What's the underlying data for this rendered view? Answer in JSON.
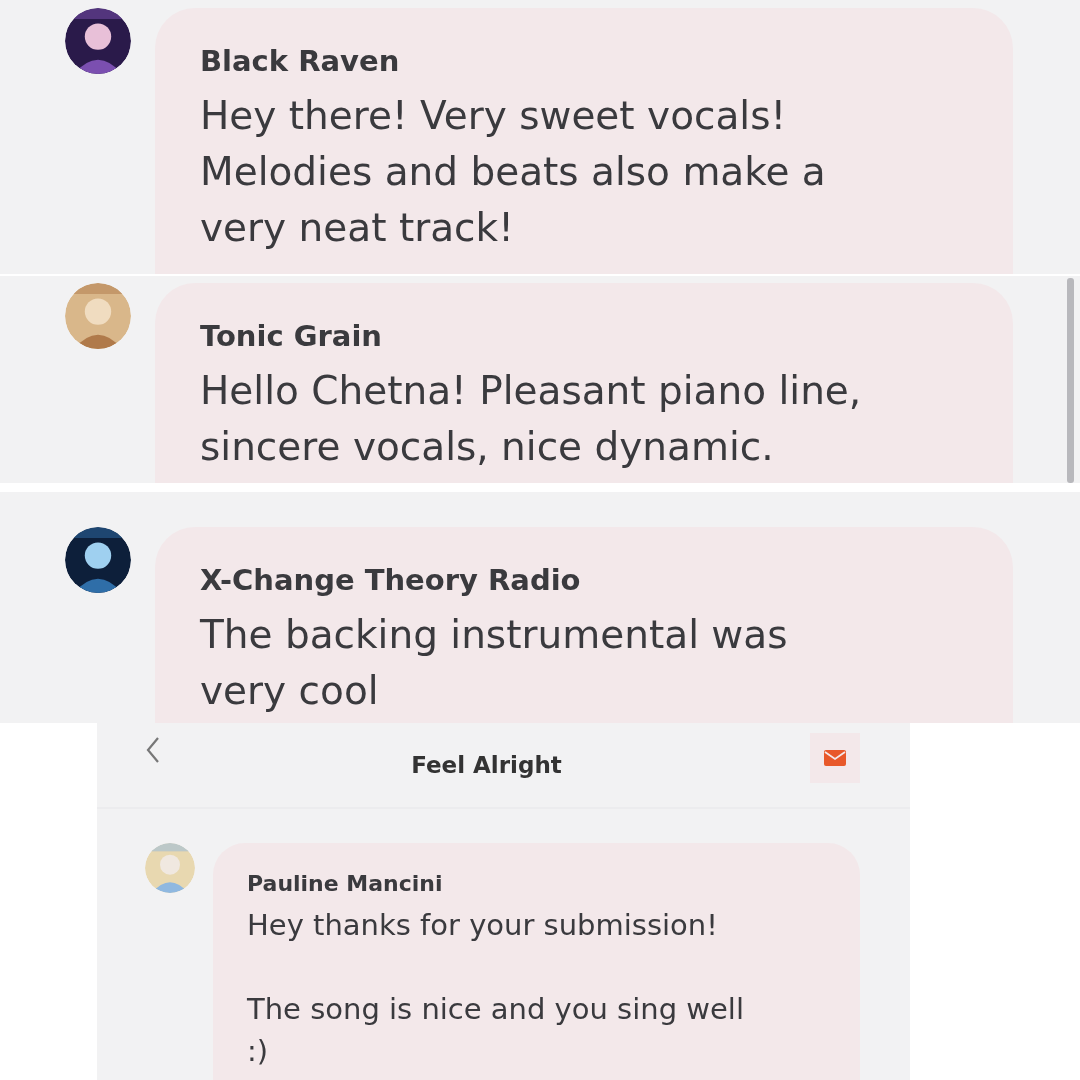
{
  "panels": [
    {
      "comments": [
        {
          "author": "Black Raven",
          "message": "Hey there! Very sweet vocals! Melodies and beats also make a very neat track!"
        }
      ],
      "scrollbar": false
    },
    {
      "comments": [
        {
          "author": "Tonic Grain",
          "message": "Hello Chetna! Pleasant piano line, sincere vocals, nice dynamic."
        }
      ],
      "scrollbar": true
    },
    {
      "comments": [
        {
          "author": "X-Change Theory Radio",
          "message": "The backing instrumental was very cool"
        }
      ],
      "scrollbar": false
    }
  ],
  "thread": {
    "title": "Feel Alright",
    "comments": [
      {
        "author": "Pauline Mancini",
        "message": "Hey thanks for your submission!\n\nThe song is nice and you sing well :)"
      }
    ]
  }
}
